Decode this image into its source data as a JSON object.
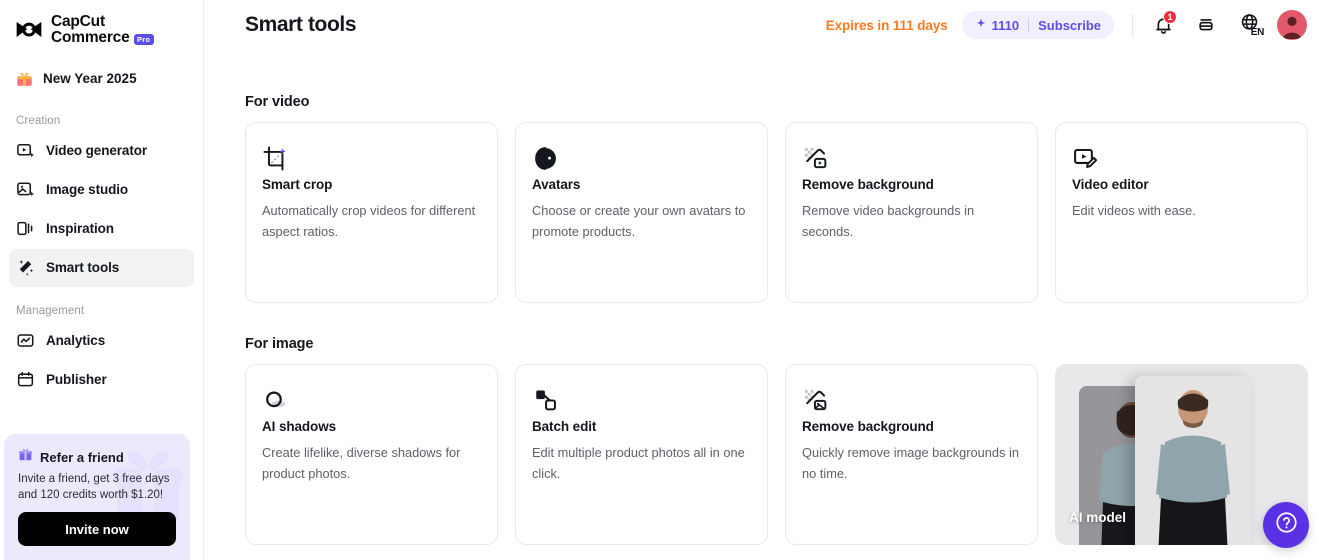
{
  "brand": {
    "line1": "CapCut",
    "line2": "Commerce",
    "pro_badge": "Pro",
    "logo_icon": "capcut-logo-icon"
  },
  "sidebar": {
    "promo": {
      "label": "New Year 2025",
      "icon": "gift-icon"
    },
    "sections": [
      {
        "title": "Creation",
        "items": [
          {
            "label": "Video generator",
            "icon": "video-generator-icon",
            "active": false
          },
          {
            "label": "Image studio",
            "icon": "image-studio-icon",
            "active": false
          },
          {
            "label": "Inspiration",
            "icon": "inspiration-icon",
            "active": false
          },
          {
            "label": "Smart tools",
            "icon": "magic-wand-icon",
            "active": true
          }
        ]
      },
      {
        "title": "Management",
        "items": [
          {
            "label": "Analytics",
            "icon": "analytics-icon",
            "active": false
          },
          {
            "label": "Publisher",
            "icon": "publisher-calendar-icon",
            "active": false
          }
        ]
      }
    ],
    "refer": {
      "icon": "gift-box-icon",
      "title": "Refer a friend",
      "body": "Invite a friend, get 3 free days and 120 credits worth $1.20!",
      "button_label": "Invite now"
    }
  },
  "header": {
    "title": "Smart tools",
    "expires_text": "Expires in 111 days",
    "credits": "1110",
    "credits_icon": "sparkle-icon",
    "subscribe_label": "Subscribe",
    "notification_icon": "bell-icon",
    "notification_count": "1",
    "wallet_icon": "wallet-icon",
    "language_icon": "globe-icon",
    "language_code": "EN",
    "avatar_icon": "user-avatar"
  },
  "colors": {
    "accent_purple": "#5b4ee6",
    "expiry_orange": "#ff7a20",
    "badge_red": "#fa2c3b",
    "pill_bg": "#f2f0fe",
    "refer_bg": "#ece9fd",
    "help_fab": "#5b31e6",
    "avatar_bg": "#e2596a"
  },
  "main": {
    "sections": [
      {
        "title": "For video",
        "cards": [
          {
            "type": "tool",
            "icon": "smart-crop-icon",
            "title": "Smart crop",
            "desc": "Automatically crop videos for different aspect ratios."
          },
          {
            "type": "tool",
            "icon": "avatars-icon",
            "title": "Avatars",
            "desc": "Choose or create your own avatars to promote products."
          },
          {
            "type": "tool",
            "icon": "remove-background-video-icon",
            "title": "Remove background",
            "desc": "Remove video backgrounds in seconds."
          },
          {
            "type": "tool",
            "icon": "video-editor-icon",
            "title": "Video editor",
            "desc": "Edit videos with ease."
          }
        ]
      },
      {
        "title": "For image",
        "cards": [
          {
            "type": "tool",
            "icon": "ai-shadows-icon",
            "title": "AI shadows",
            "desc": "Create lifelike, diverse shadows for product photos."
          },
          {
            "type": "tool",
            "icon": "batch-edit-icon",
            "title": "Batch edit",
            "desc": "Edit multiple product photos all in one click."
          },
          {
            "type": "tool",
            "icon": "remove-background-image-icon",
            "title": "Remove background",
            "desc": "Quickly remove image backgrounds in no time."
          },
          {
            "type": "media",
            "icon": "ai-model-photo",
            "title": "AI model",
            "desc": ""
          }
        ]
      }
    ],
    "help_button": {
      "icon": "question-mark-icon"
    }
  }
}
